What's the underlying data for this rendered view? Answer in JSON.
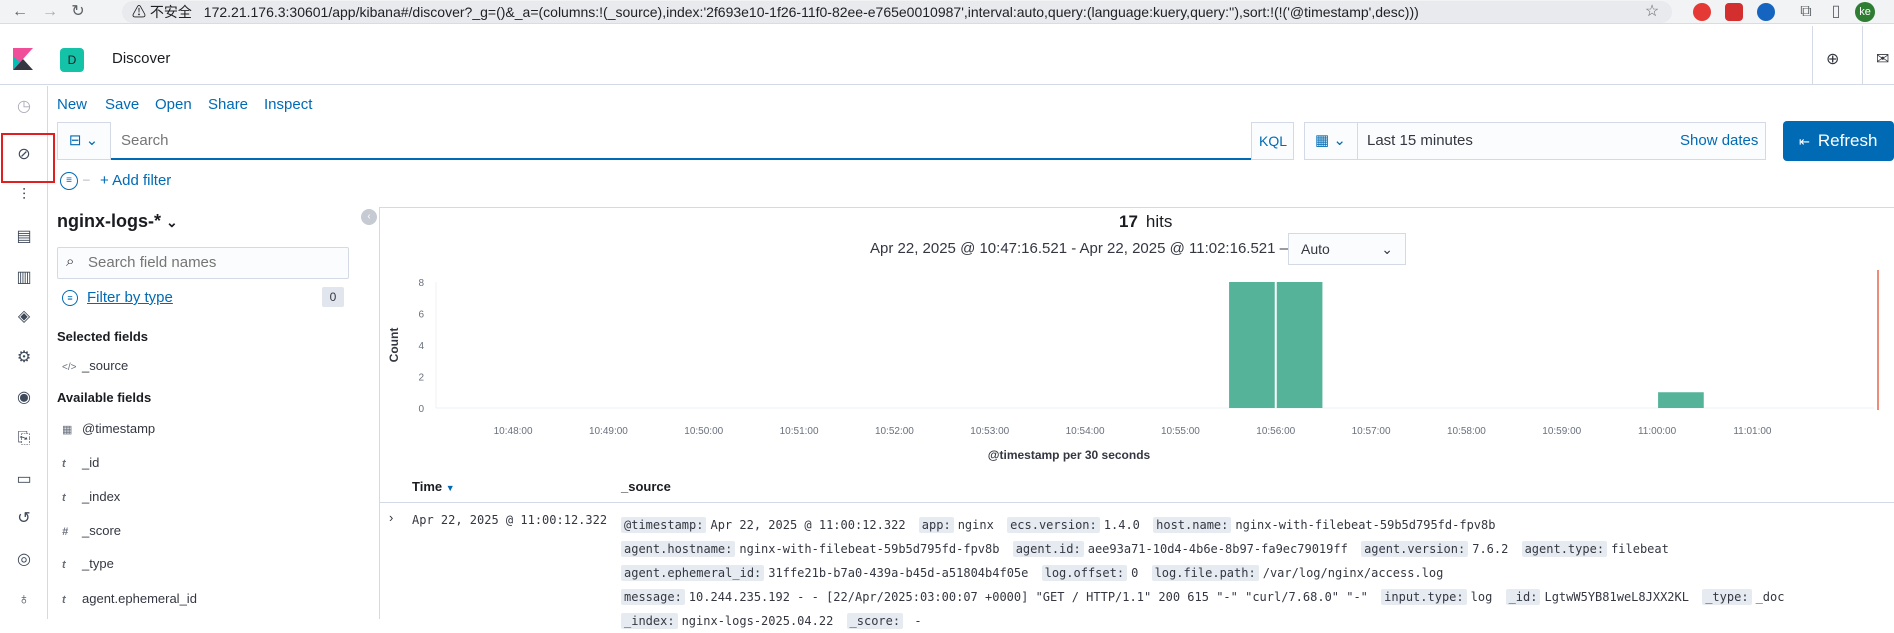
{
  "browser": {
    "security_label": "不安全",
    "url": "172.21.176.3:30601/app/kibana#/discover?_g=()&_a=(columns:!(_source),index:'2f693e10-1f26-11f0-82ee-e765e0010987',interval:auto,query:(language:kuery,query:''),sort:!(!('@timestamp',desc)))",
    "profile_initials": "ke"
  },
  "header": {
    "space_initial": "D",
    "app_title": "Discover"
  },
  "top_menu": [
    "New",
    "Save",
    "Open",
    "Share",
    "Inspect"
  ],
  "query_bar": {
    "placeholder": "Search",
    "language_button": "KQL",
    "date_range": "Last 15 minutes",
    "show_dates": "Show dates",
    "refresh_label": "Refresh"
  },
  "filter_bar": {
    "add_filter": "+ Add filter"
  },
  "sidebar": {
    "index_pattern": "nginx-logs-*",
    "field_search_placeholder": "Search field names",
    "filter_by_type": "Filter by type",
    "filter_count": "0",
    "selected_heading": "Selected fields",
    "selected_fields": [
      {
        "type": "</>",
        "name": "_source"
      }
    ],
    "available_heading": "Available fields",
    "available_fields": [
      {
        "type": "▦",
        "name": "@timestamp"
      },
      {
        "type": "t",
        "name": "_id"
      },
      {
        "type": "t",
        "name": "_index"
      },
      {
        "type": "#",
        "name": "_score"
      },
      {
        "type": "t",
        "name": "_type"
      },
      {
        "type": "t",
        "name": "agent.ephemeral_id"
      }
    ]
  },
  "results": {
    "hits_count": "17",
    "hits_label": "hits",
    "time_range": "Apr 22, 2025 @ 10:47:16.521 - Apr 22, 2025 @ 11:02:16.521 —",
    "interval": "Auto"
  },
  "chart_data": {
    "type": "bar",
    "xlabel": "@timestamp per 30 seconds",
    "ylabel": "Count",
    "ylim": [
      0,
      8
    ],
    "yticks": [
      0,
      2,
      4,
      6,
      8
    ],
    "x_ticks": [
      "10:48:00",
      "10:49:00",
      "10:50:00",
      "10:51:00",
      "10:52:00",
      "10:53:00",
      "10:54:00",
      "10:55:00",
      "10:56:00",
      "10:57:00",
      "10:58:00",
      "10:59:00",
      "11:00:00",
      "11:01:00"
    ],
    "bars": [
      {
        "x": "10:55:30",
        "value": 8
      },
      {
        "x": "10:56:00",
        "value": 8
      },
      {
        "x": "11:00:00",
        "value": 1
      }
    ],
    "bar_color": "#54b399",
    "now_marker_color": "#e7664c"
  },
  "table": {
    "time_header": "Time",
    "source_header": "_source",
    "rows": [
      {
        "time": "Apr 22, 2025 @ 11:00:12.322",
        "fields": [
          {
            "k": "@timestamp:",
            "v": "Apr 22, 2025 @ 11:00:12.322"
          },
          {
            "k": "app:",
            "v": "nginx"
          },
          {
            "k": "ecs.version:",
            "v": "1.4.0"
          },
          {
            "k": "host.name:",
            "v": "nginx-with-filebeat-59b5d795fd-fpv8b"
          },
          {
            "k": "agent.hostname:",
            "v": "nginx-with-filebeat-59b5d795fd-fpv8b"
          },
          {
            "k": "agent.id:",
            "v": "aee93a71-10d4-4b6e-8b97-fa9ec79019ff"
          },
          {
            "k": "agent.version:",
            "v": "7.6.2"
          },
          {
            "k": "agent.type:",
            "v": "filebeat"
          },
          {
            "k": "agent.ephemeral_id:",
            "v": "31ffe21b-b7a0-439a-b45d-a51804b4f05e"
          },
          {
            "k": "log.offset:",
            "v": "0"
          },
          {
            "k": "log.file.path:",
            "v": "/var/log/nginx/access.log"
          },
          {
            "k": "message:",
            "v": "10.244.235.192 - - [22/Apr/2025:03:00:07 +0000] \"GET / HTTP/1.1\" 200 615 \"-\" \"curl/7.68.0\" \"-\""
          },
          {
            "k": "input.type:",
            "v": "log"
          },
          {
            "k": "_id:",
            "v": "LgtwW5YB81weL8JXX2KL"
          },
          {
            "k": "_type:",
            "v": "_doc"
          },
          {
            "k": "_index:",
            "v": "nginx-logs-2025.04.22"
          },
          {
            "k": "_score:",
            "v": " -"
          }
        ]
      }
    ]
  },
  "colors": {
    "link": "#006bb4",
    "refresh_bg": "#006bb4",
    "highlight_border": "#e02020"
  }
}
